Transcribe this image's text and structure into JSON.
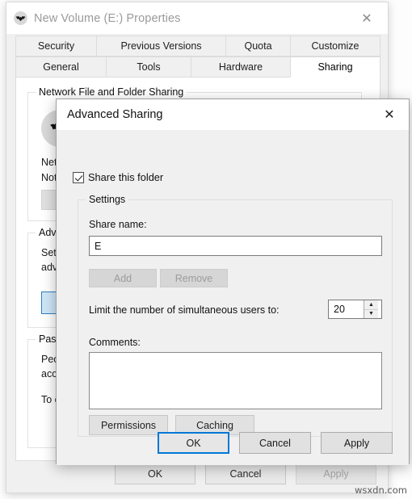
{
  "parent_window": {
    "title": "New Volume (E:) Properties",
    "icon": "bat-logo-icon",
    "close_label": "✕",
    "tabs_row1": [
      {
        "label": "Security",
        "active": false
      },
      {
        "label": "Previous Versions",
        "active": false
      },
      {
        "label": "Quota",
        "active": false
      },
      {
        "label": "Customize",
        "active": false
      }
    ],
    "tabs_row2": [
      {
        "label": "General",
        "active": false
      },
      {
        "label": "Tools",
        "active": false
      },
      {
        "label": "Hardware",
        "active": false
      },
      {
        "label": "Sharing",
        "active": true
      }
    ],
    "groups": {
      "network_sharing": {
        "title": "Network File and Folder Sharing",
        "line1": "Netw",
        "line2": "Not S"
      },
      "advanced_sharing": {
        "title": "Adva",
        "line1": "Set o",
        "line2": "adva"
      },
      "password_protection": {
        "title": "Pass",
        "line1": "Peop",
        "line2": "acce",
        "line3": "To c"
      }
    },
    "buttons": {
      "ok": "OK",
      "cancel": "Cancel",
      "apply": "Apply"
    }
  },
  "advanced_dialog": {
    "title": "Advanced Sharing",
    "close_label": "✕",
    "share_this_folder": {
      "label": "Share this folder",
      "checked": true
    },
    "settings": {
      "title": "Settings",
      "share_name_label": "Share name:",
      "share_name_value": "E",
      "add_label": "Add",
      "add_disabled": true,
      "remove_label": "Remove",
      "remove_disabled": true,
      "limit_label": "Limit the number of simultaneous users to:",
      "limit_value": "20",
      "spinner_up": "▲",
      "spinner_down": "▼",
      "comments_label": "Comments:",
      "comments_value": "",
      "permissions_label": "Permissions",
      "caching_label": "Caching"
    },
    "buttons": {
      "ok": "OK",
      "cancel": "Cancel",
      "apply": "Apply"
    }
  },
  "watermark": "wsxdn.com",
  "colors": {
    "accent": "#0078d7",
    "dialog_bg": "#f0f0f0",
    "window_bg": "#ffffff"
  }
}
